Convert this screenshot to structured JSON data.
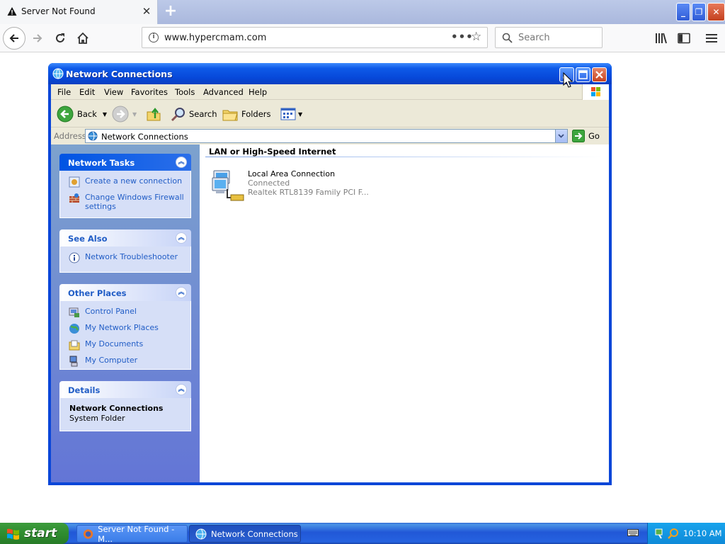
{
  "browser": {
    "tab_title": "Server Not Found",
    "new_tab_label": "+",
    "url": "www.hypercmam.com",
    "search_placeholder": "Search",
    "page_actions": "•••"
  },
  "window": {
    "title": "Network Connections",
    "menu": [
      "File",
      "Edit",
      "View",
      "Favorites",
      "Tools",
      "Advanced",
      "Help"
    ],
    "toolbar": {
      "back": "Back",
      "search": "Search",
      "folders": "Folders"
    },
    "address_label": "Address",
    "address_value": "Network Connections",
    "go_label": "Go"
  },
  "taskpane": {
    "network_tasks": {
      "title": "Network Tasks",
      "links": [
        "Create a new connection",
        "Change Windows Firewall settings"
      ]
    },
    "see_also": {
      "title": "See Also",
      "links": [
        "Network Troubleshooter"
      ]
    },
    "other_places": {
      "title": "Other Places",
      "links": [
        "Control Panel",
        "My Network Places",
        "My Documents",
        "My Computer"
      ]
    },
    "details": {
      "title": "Details",
      "name": "Network Connections",
      "type": "System Folder"
    }
  },
  "content": {
    "group_heading": "LAN or High-Speed Internet",
    "connection": {
      "name": "Local Area Connection",
      "status": "Connected",
      "device": "Realtek RTL8139 Family PCI F..."
    }
  },
  "taskbar": {
    "start_label": "start",
    "items": [
      "Server Not Found - M...",
      "Network Connections"
    ],
    "clock": "10:10 AM"
  }
}
